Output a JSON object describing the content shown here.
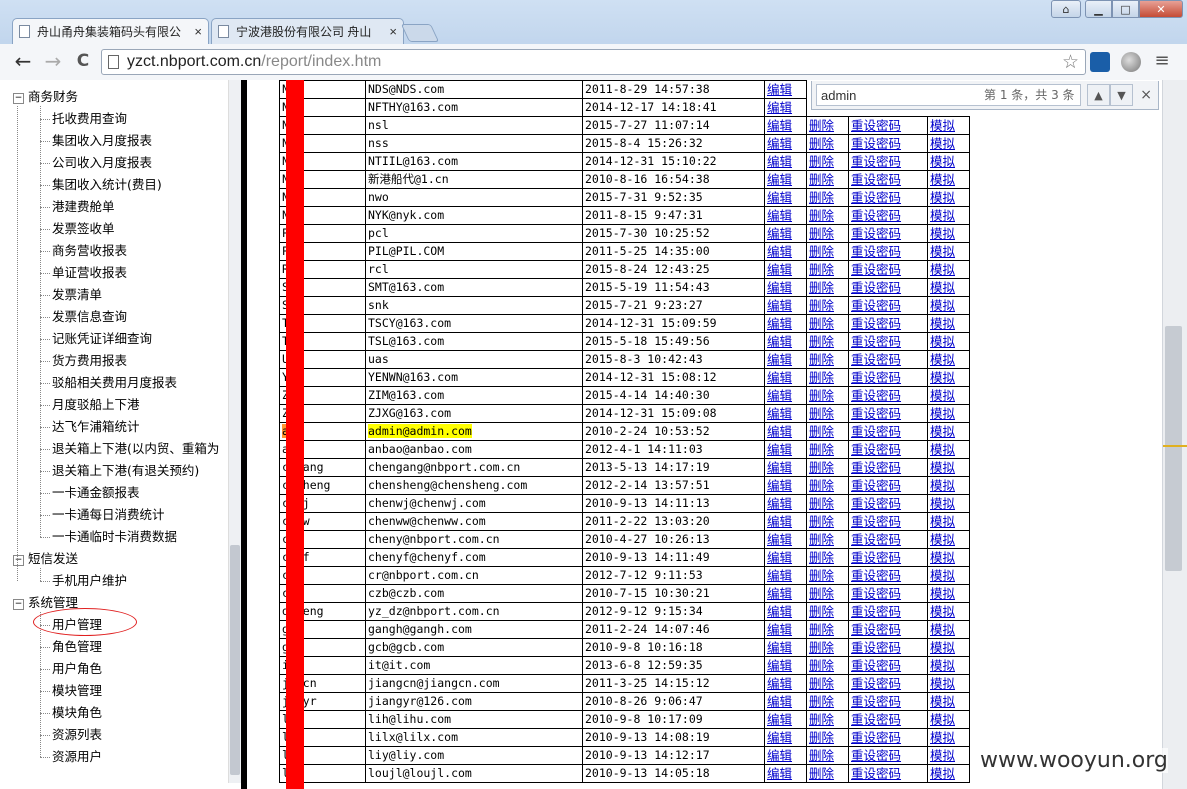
{
  "browser": {
    "tabs": [
      {
        "title": "舟山甬舟集装箱码头有限公",
        "close": "×"
      },
      {
        "title": "宁波港股份有限公司 舟山",
        "close": "×"
      }
    ],
    "url_host": "yzct.nbport.com.cn",
    "url_path": "/report/index.htm",
    "window_buttons": {
      "user": "⌂",
      "min": "▁",
      "max": "□",
      "close": "✕"
    },
    "back": "←",
    "forward": "→",
    "reload": "C",
    "menu": "≡"
  },
  "find_bar": {
    "query": "admin",
    "count": "第 1 条，共 3 条",
    "prev": "▲",
    "next": "▼",
    "close": "×"
  },
  "tree": {
    "groups": [
      {
        "label": "商务财务",
        "expander": "−"
      },
      {
        "label": "短信发送",
        "expander": "−"
      },
      {
        "label": "系统管理",
        "expander": "−"
      }
    ],
    "finance_items": [
      "托收费用查询",
      "集团收入月度报表",
      "公司收入月度报表",
      "集团收入统计(费目)",
      "港建费舱单",
      "发票签收单",
      "商务营收报表",
      "单证营收报表",
      "发票清单",
      "发票信息查询",
      "记账凭证详细查询",
      "货方费用报表",
      "驳船相关费用月度报表",
      "月度驳船上下港",
      "达飞乍浦箱统计",
      "退关箱上下港(以内贸、重箱为",
      "退关箱上下港(有退关预约)",
      "一卡通金额报表",
      "一卡通每日消费统计",
      "一卡通临时卡消费数据"
    ],
    "sms_items": [
      "手机用户维护"
    ],
    "system_items": [
      "用户管理",
      "角色管理",
      "用户角色",
      "模块管理",
      "模块角色",
      "资源列表",
      "资源用户"
    ]
  },
  "table": {
    "actions": {
      "edit": "编辑",
      "delete": "删除",
      "reset": "重设密码",
      "simulate": "模拟"
    },
    "rows": [
      {
        "user": "N",
        "email": "NDS@NDS.com",
        "time": "2011-8-29 14:57:38"
      },
      {
        "user": "N      Y",
        "email": "NFTHY@163.com",
        "time": "2014-12-17 14:18:41"
      },
      {
        "user": "N",
        "email": "nsl",
        "time": "2015-7-27 11:07:14"
      },
      {
        "user": "N",
        "email": "nss",
        "time": "2015-8-4 15:26:32"
      },
      {
        "user": "N     L",
        "email": "NTIIL@163.com",
        "time": "2014-12-31 15:10:22"
      },
      {
        "user": "N",
        "email": "新港船代@1.cn",
        "time": "2010-8-16 16:54:38"
      },
      {
        "user": "N",
        "email": "nwo",
        "time": "2015-7-31 9:52:35"
      },
      {
        "user": "N",
        "email": "NYK@nyk.com",
        "time": "2011-8-15 9:47:31"
      },
      {
        "user": "P",
        "email": "pcl",
        "time": "2015-7-30 10:25:52"
      },
      {
        "user": "P",
        "email": "PIL@PIL.COM",
        "time": "2011-5-25 14:35:00"
      },
      {
        "user": "R",
        "email": "rcl",
        "time": "2015-8-24 12:43:25"
      },
      {
        "user": "S",
        "email": "SMT@163.com",
        "time": "2015-5-19 11:54:43"
      },
      {
        "user": "S",
        "email": "snk",
        "time": "2015-7-21 9:23:27"
      },
      {
        "user": "T",
        "email": "TSCY@163.com",
        "time": "2014-12-31 15:09:59"
      },
      {
        "user": "T",
        "email": "TSL@163.com",
        "time": "2015-5-18 15:49:56"
      },
      {
        "user": "U",
        "email": "uas",
        "time": "2015-8-3 10:42:43"
      },
      {
        "user": "Y    N",
        "email": "YENWN@163.com",
        "time": "2014-12-31 15:08:12"
      },
      {
        "user": "Z",
        "email": "ZIM@163.com",
        "time": "2015-4-14 14:40:30"
      },
      {
        "user": "Z",
        "email": "ZJXG@163.com",
        "time": "2014-12-31 15:09:08"
      },
      {
        "user": "a    n",
        "email": "admin@admin.com",
        "time": "2010-2-24 10:53:52",
        "highlight": true
      },
      {
        "user": "a    o",
        "email": "anbao@anbao.com",
        "time": "2012-4-1 14:11:03"
      },
      {
        "user": "c   gang",
        "email": "chengang@nbport.com.cn",
        "time": "2013-5-13 14:17:19"
      },
      {
        "user": "c   sheng",
        "email": "chensheng@chensheng.com",
        "time": "2012-2-14 13:57:51"
      },
      {
        "user": "c   wj",
        "email": "chenwj@chenwj.com",
        "time": "2010-9-13 14:11:13"
      },
      {
        "user": "c   ww",
        "email": "chenww@chenww.com",
        "time": "2011-2-22 13:03:20"
      },
      {
        "user": "c   y",
        "email": "cheny@nbport.com.cn",
        "time": "2010-4-27 10:26:13"
      },
      {
        "user": "c   yf",
        "email": "chenyf@chenyf.com",
        "time": "2010-9-13 14:11:49"
      },
      {
        "user": "c",
        "email": "cr@nbport.com.cn",
        "time": "2012-7-12 9:11:53"
      },
      {
        "user": "c",
        "email": "czb@czb.com",
        "time": "2010-7-15 10:30:21"
      },
      {
        "user": "d   heng",
        "email": "yz_dz@nbport.com.cn",
        "time": "2012-9-12 9:15:34"
      },
      {
        "user": "g   h",
        "email": "gangh@gangh.com",
        "time": "2011-2-24 14:07:46"
      },
      {
        "user": "g",
        "email": "gcb@gcb.com",
        "time": "2010-9-8 10:16:18"
      },
      {
        "user": "i",
        "email": "it@it.com",
        "time": "2013-6-8 12:59:35"
      },
      {
        "user": "j   gcn",
        "email": "jiangcn@jiangcn.com",
        "time": "2011-3-25 14:15:12"
      },
      {
        "user": "j   gyr",
        "email": "jiangyr@126.com",
        "time": "2010-8-26 9:06:47"
      },
      {
        "user": "l",
        "email": "lih@lihu.com",
        "time": "2010-9-8 10:17:09"
      },
      {
        "user": "l",
        "email": "lilx@lilx.com",
        "time": "2010-9-13 14:08:19"
      },
      {
        "user": "l",
        "email": "liy@liy.com",
        "time": "2010-9-13 14:12:17"
      },
      {
        "user": "l   l",
        "email": "loujl@loujl.com",
        "time": "2010-9-13 14:05:18"
      }
    ]
  },
  "watermark": "www.wooyun.org",
  "colors": {
    "link": "#0000cc",
    "highlight": "#ffff00",
    "redaction": "#ff0000",
    "circle": "#e02020"
  }
}
